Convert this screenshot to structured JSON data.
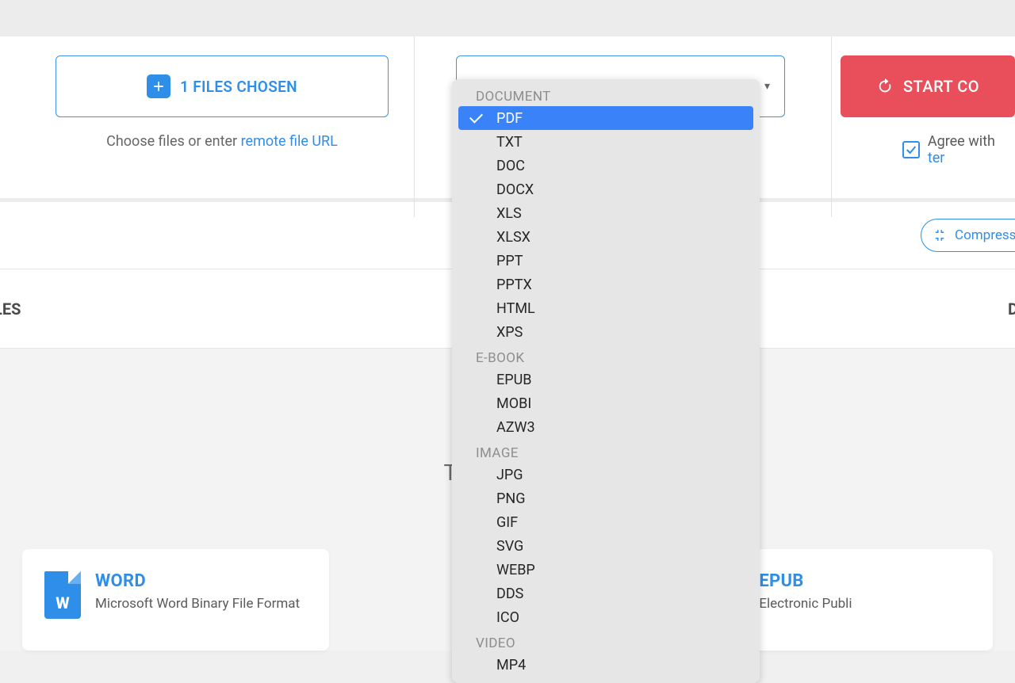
{
  "upload": {
    "button_label": "1 FILES CHOSEN",
    "subtext_prefix": "Choose files or enter ",
    "subtext_link": "remote file URL"
  },
  "format_dropdown": {
    "selected": "PDF",
    "groups": [
      {
        "name": "DOCUMENT",
        "options": [
          "PDF",
          "TXT",
          "DOC",
          "DOCX",
          "XLS",
          "XLSX",
          "PPT",
          "PPTX",
          "HTML",
          "XPS"
        ]
      },
      {
        "name": "E-BOOK",
        "options": [
          "EPUB",
          "MOBI",
          "AZW3"
        ]
      },
      {
        "name": "IMAGE",
        "options": [
          "JPG",
          "PNG",
          "GIF",
          "SVG",
          "WEBP",
          "DDS",
          "ICO"
        ]
      },
      {
        "name": "VIDEO",
        "options": [
          "MP4"
        ]
      }
    ]
  },
  "start_button": {
    "label": "START CO"
  },
  "agree": {
    "prefix": "Agree with ",
    "link": "ter"
  },
  "toolbar": {
    "compress_label": "Compress al"
  },
  "table_headers": {
    "left_fragment": "LES",
    "right_fragment": "D"
  },
  "top_formats": {
    "heading": "Top File Forn",
    "cards": [
      {
        "title": "WORD",
        "desc": "Microsoft Word Binary File Format",
        "glyph": "W",
        "style": "glyph"
      },
      {
        "title": "",
        "desc": "",
        "glyph": "",
        "style": "hidden"
      },
      {
        "title": "EPUB",
        "desc": "Electronic Publi",
        "glyph": "",
        "style": "lines"
      }
    ]
  }
}
